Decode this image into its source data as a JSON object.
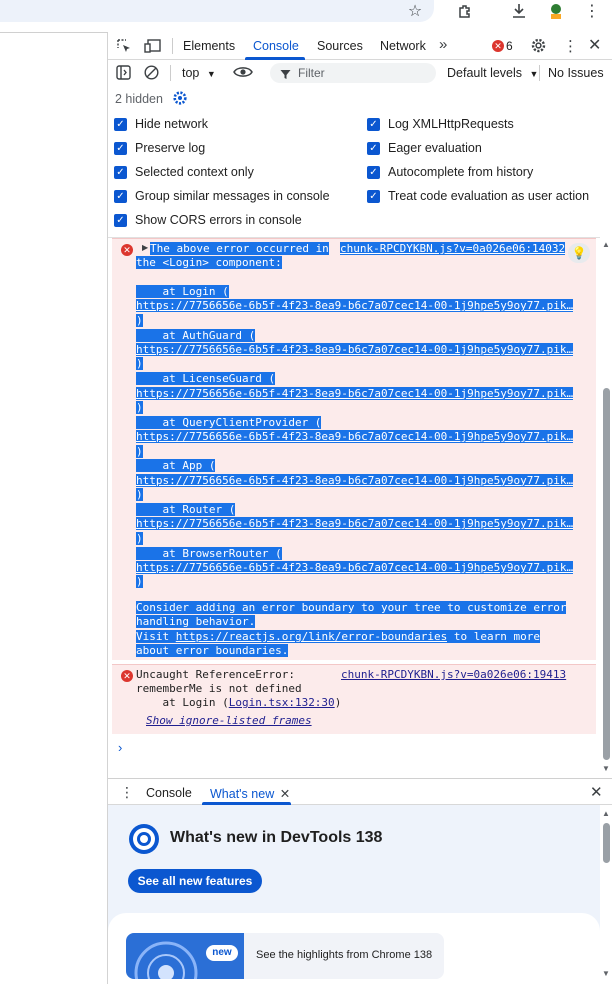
{
  "devtools": {
    "tabs": [
      "Elements",
      "Console",
      "Sources",
      "Network"
    ],
    "active_tab": "Console",
    "error_count": "6"
  },
  "toolbar": {
    "context": "top",
    "filter_placeholder": "Filter",
    "levels": "Default levels",
    "issues": "No Issues",
    "hidden": "2 hidden"
  },
  "settings": {
    "left": [
      "Hide network",
      "Preserve log",
      "Selected context only",
      "Group similar messages in console",
      "Show CORS errors in console"
    ],
    "right": [
      "Log XMLHttpRequests",
      "Eager evaluation",
      "Autocomplete from history",
      "Treat code evaluation as user action"
    ]
  },
  "errors": {
    "first": {
      "head": "The above error occurred in",
      "source": "chunk-RPCDYKBN.js?v=0a026e06:14032",
      "line2": "the <Login> component:",
      "frames": [
        {
          "at": "    at Login (",
          "url": "https://7756656e-6b5f-4f23-8ea9-b6c7a07cec14-00-1j9hpe5y9oy77.pik…",
          "close": ")"
        },
        {
          "at": "    at AuthGuard (",
          "url": "https://7756656e-6b5f-4f23-8ea9-b6c7a07cec14-00-1j9hpe5y9oy77.pik…",
          "close": ")"
        },
        {
          "at": "    at LicenseGuard (",
          "url": "https://7756656e-6b5f-4f23-8ea9-b6c7a07cec14-00-1j9hpe5y9oy77.pik…",
          "close": ")"
        },
        {
          "at": "    at QueryClientProvider (",
          "url": "https://7756656e-6b5f-4f23-8ea9-b6c7a07cec14-00-1j9hpe5y9oy77.pik…",
          "close": ")"
        },
        {
          "at": "    at App (",
          "url": "https://7756656e-6b5f-4f23-8ea9-b6c7a07cec14-00-1j9hpe5y9oy77.pik…",
          "close": ")"
        },
        {
          "at": "    at Router (",
          "url": "https://7756656e-6b5f-4f23-8ea9-b6c7a07cec14-00-1j9hpe5y9oy77.pik…",
          "close": ")"
        },
        {
          "at": "    at BrowserRouter (",
          "url": "https://7756656e-6b5f-4f23-8ea9-b6c7a07cec14-00-1j9hpe5y9oy77.pik…",
          "close": ")"
        }
      ],
      "consider1": "Consider adding an error boundary to your tree to customize error",
      "consider2": "handling behavior.",
      "visit": "Visit",
      "visit_link": "https://reactjs.org/link/error-boundaries",
      "visit_rest": "to learn more",
      "about": "about error boundaries."
    },
    "second": {
      "line1": "Uncaught ReferenceError:",
      "source": "chunk-RPCDYKBN.js?v=0a026e06:19413",
      "line2": "rememberMe is not defined",
      "line3_pre": "    at Login (",
      "line3_link": "Login.tsx:132:30",
      "line3_post": ")",
      "ignore_link": "Show ignore-listed frames"
    }
  },
  "drawer": {
    "tabs": [
      "Console",
      "What's new"
    ],
    "title": "What's new in DevTools 138",
    "button": "See all new features",
    "badge": "new",
    "highlight": "See the highlights from Chrome 138"
  },
  "colors": {
    "accent": "#0b57d0",
    "error_bg": "#fcebeb",
    "selection": "#1a73e8"
  }
}
